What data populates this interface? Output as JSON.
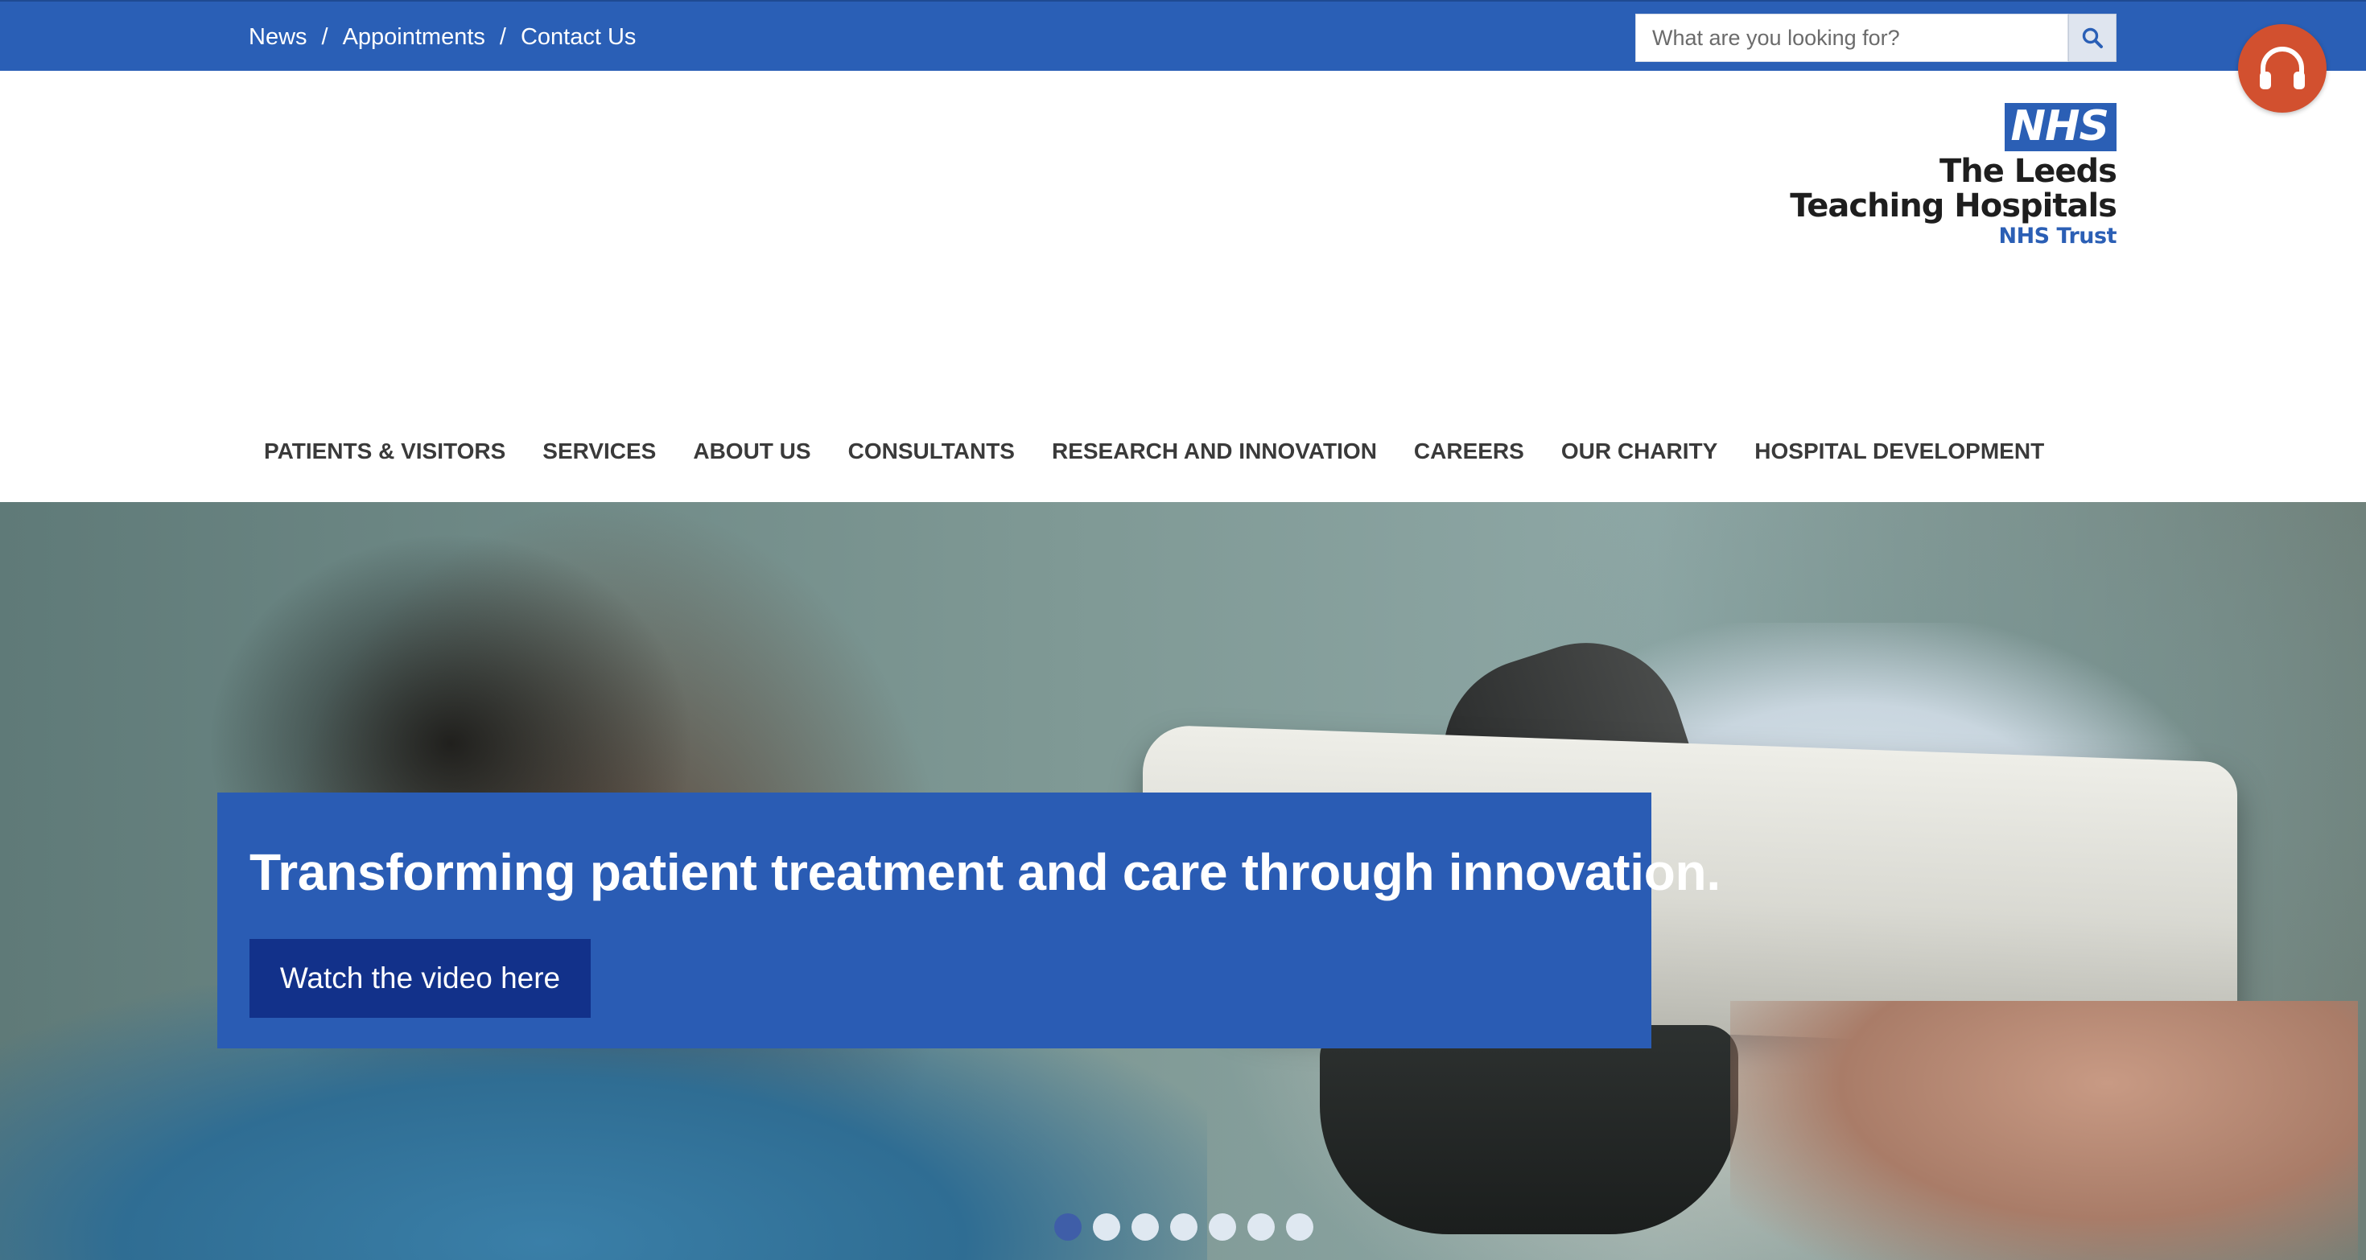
{
  "util_nav": {
    "links": [
      "News",
      "Appointments",
      "Contact Us"
    ],
    "separator": "/"
  },
  "search": {
    "placeholder": "What are you looking for?",
    "value": "",
    "button_icon": "search-icon"
  },
  "audio_button": {
    "icon": "headphones-icon",
    "color": "#d2502f"
  },
  "logo": {
    "badge": "NHS",
    "name_line1": "The Leeds",
    "name_line2": "Teaching Hospitals",
    "trust": "NHS Trust",
    "color": "#2b5fb5"
  },
  "main_nav": {
    "items": [
      "PATIENTS & VISITORS",
      "SERVICES",
      "ABOUT US",
      "CONSULTANTS",
      "RESEARCH AND INNOVATION",
      "CAREERS",
      "OUR CHARITY",
      "HOSPITAL DEVELOPMENT"
    ]
  },
  "hero": {
    "headline": "Transforming patient treatment and care through innovation.",
    "cta_label": "Watch the video here",
    "card_color": "#2a5cb4",
    "cta_color": "#12318a",
    "slide_count": 7,
    "active_slide": 1
  },
  "colors": {
    "brand_blue": "#2a5fb6",
    "nav_text": "#3a3a3a"
  }
}
